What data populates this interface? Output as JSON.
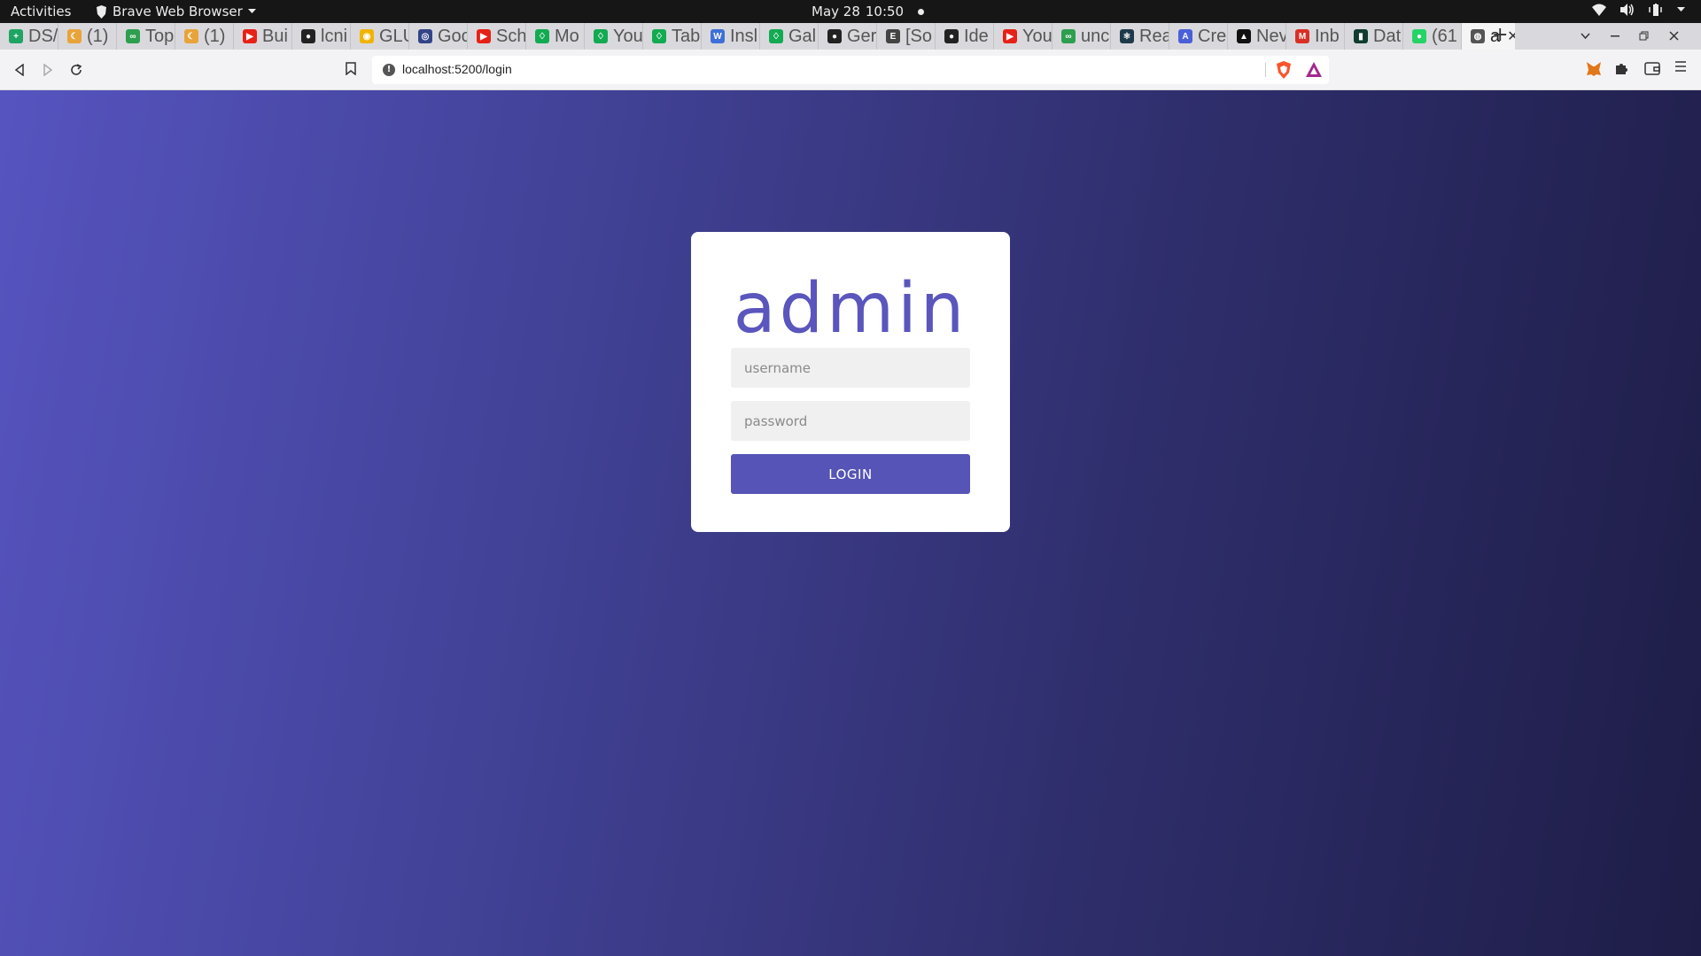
{
  "system_bar": {
    "activities": "Activities",
    "app_name": "Brave Web Browser",
    "date": "May 28",
    "time": "10:50"
  },
  "tabs": [
    {
      "label": "DS/",
      "favicon": "sheets-icon",
      "color": "#1fa463"
    },
    {
      "label": "(1)",
      "favicon": "moon-icon",
      "color": "#e8a33a"
    },
    {
      "label": "Top",
      "favicon": "link-icon",
      "color": "#2e9e4f"
    },
    {
      "label": "(1)",
      "favicon": "moon-icon",
      "color": "#e8a33a"
    },
    {
      "label": "Bui",
      "favicon": "youtube-icon",
      "color": "#e62117"
    },
    {
      "label": "lcni",
      "favicon": "github-icon",
      "color": "#222222"
    },
    {
      "label": "GLU",
      "favicon": "circle-logo-icon",
      "color": "#f0b400"
    },
    {
      "label": "Goo",
      "favicon": "people-icon",
      "color": "#334488"
    },
    {
      "label": "Sch",
      "favicon": "youtube-icon",
      "color": "#e62117"
    },
    {
      "label": "Mo",
      "favicon": "leaf-icon",
      "color": "#13aa52"
    },
    {
      "label": "You",
      "favicon": "leaf-icon",
      "color": "#13aa52"
    },
    {
      "label": "Tab",
      "favicon": "leaf-icon",
      "color": "#13aa52"
    },
    {
      "label": "Insl",
      "favicon": "w-icon",
      "color": "#3f6fd8"
    },
    {
      "label": "Gal",
      "favicon": "leaf-icon",
      "color": "#13aa52"
    },
    {
      "label": "Ger",
      "favicon": "github-icon",
      "color": "#222222"
    },
    {
      "label": "[So",
      "favicon": "doc-icon",
      "color": "#444444"
    },
    {
      "label": "Ide",
      "favicon": "github-icon",
      "color": "#222222"
    },
    {
      "label": "You",
      "favicon": "youtube-icon",
      "color": "#e62117"
    },
    {
      "label": "unc",
      "favicon": "link-icon",
      "color": "#2e9e4f"
    },
    {
      "label": "Rea",
      "favicon": "react-icon",
      "color": "#1e3a4a"
    },
    {
      "label": "Cre",
      "favicon": "api-icon",
      "color": "#4a5fd8"
    },
    {
      "label": "Nev",
      "favicon": "triangle-icon",
      "color": "#111111"
    },
    {
      "label": "Inb",
      "favicon": "gmail-icon",
      "color": "#d93025"
    },
    {
      "label": "Dat",
      "favicon": "mongo-icon",
      "color": "#0f3d2e"
    },
    {
      "label": "(61",
      "favicon": "whatsapp-icon",
      "color": "#25d366"
    }
  ],
  "active_tab": {
    "label": "a",
    "favicon": "globe-icon"
  },
  "address_bar": {
    "url": "localhost:5200/login"
  },
  "login": {
    "logo_text": "admin",
    "username_placeholder": "username",
    "password_placeholder": "password",
    "button_label": "LOGIN"
  },
  "colors": {
    "accent": "#5654b6",
    "bg_start": "#5654bf",
    "bg_end": "#1e1d47"
  }
}
